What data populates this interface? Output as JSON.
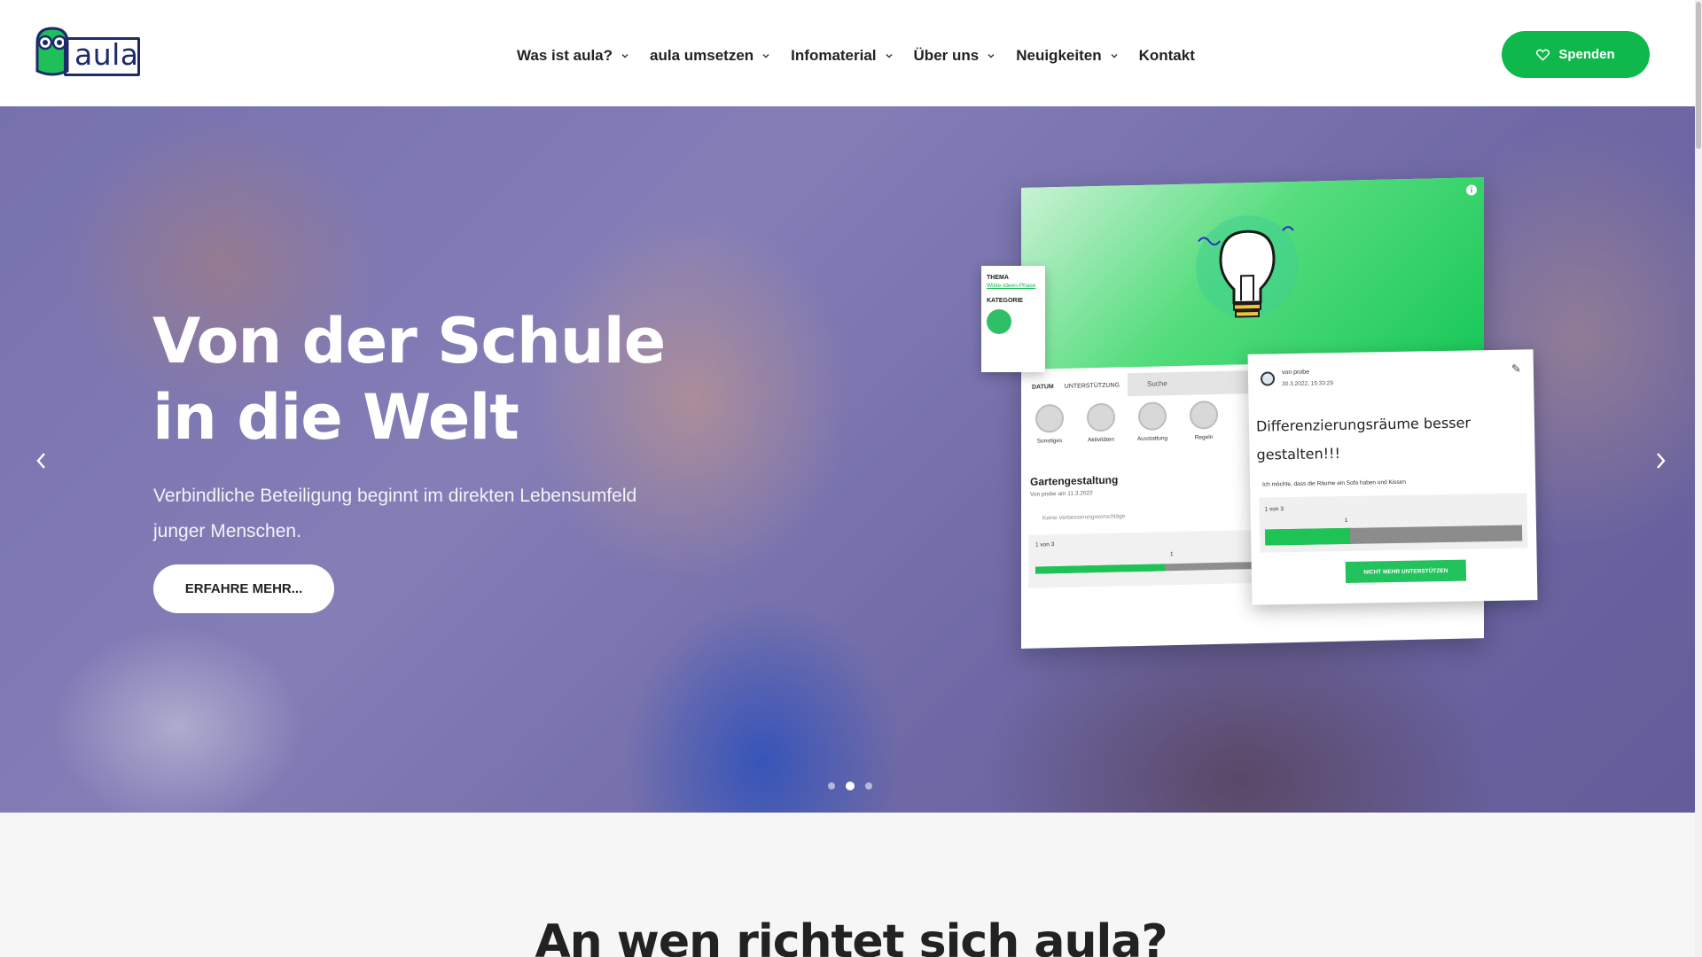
{
  "brand": {
    "logo_text": "aula"
  },
  "nav": {
    "items": [
      {
        "label": "Was ist aula?",
        "has_dropdown": true
      },
      {
        "label": "aula umsetzen",
        "has_dropdown": true
      },
      {
        "label": "Infomaterial",
        "has_dropdown": true
      },
      {
        "label": "Über uns",
        "has_dropdown": true
      },
      {
        "label": "Neuigkeiten",
        "has_dropdown": true
      },
      {
        "label": "Kontakt",
        "has_dropdown": false
      }
    ],
    "donate_label": "Spenden"
  },
  "hero": {
    "title": "Von der Schule in die Welt",
    "subtitle": "Verbindliche Beteiligung beginnt im direkten Lebensumfeld junger Menschen.",
    "cta_label": "ERFAHRE MEHR...",
    "slides_total": 3,
    "active_slide": 2
  },
  "mockup": {
    "tag_thema_label": "THEMA",
    "tag_thema_value": "Wilde-Ideen-Phase",
    "tag_kategorie_label": "KATEGORIE",
    "tab_datum": "DATUM",
    "tab_unterstuetzung": "UNTERSTÜTZUNG",
    "search_placeholder": "Suche",
    "categories": [
      "Sonstiges",
      "Aktivitäten",
      "Ausstattung",
      "Regeln"
    ],
    "card_title": "Gartengestaltung",
    "card_meta": "Von probe am 11.3.2022",
    "card_comment": "Keine Verbesserungsvorschläge",
    "card_votes": "1 von 3",
    "card_bar_marker": "1",
    "card_progress": 0.3,
    "detail_author": "von probe",
    "detail_date": "30.3.2022, 15:33:29",
    "detail_title": "Differenzierungsräume besser gestalten!!!",
    "detail_text": "Ich möchte, dass die Räume ein Sofa haben und Kissen",
    "detail_votes": "1 von 3",
    "detail_bar_marker": "1",
    "detail_progress": 0.33,
    "detail_button": "NICHT MEHR UNTERSTÜTZEN"
  },
  "section": {
    "title": "An wen richtet sich aula?"
  },
  "colors": {
    "accent": "#0fb84a",
    "brand_navy": "#1c2a6b"
  }
}
